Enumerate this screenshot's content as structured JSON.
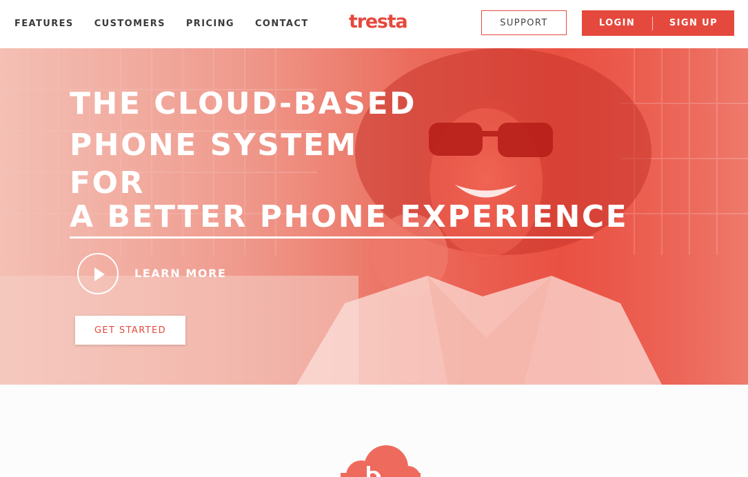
{
  "nav": {
    "links": [
      "FEATURES",
      "CUSTOMERS",
      "PRICING",
      "CONTACT"
    ],
    "logo": "tresta",
    "support_label": "SUPPORT",
    "login_label": "LOGIN",
    "signup_label": "SIGN UP"
  },
  "hero": {
    "headline": {
      "line1": "THE CLOUD-BASED",
      "line2": "PHONE SYSTEM",
      "line3": "FOR",
      "line4": "A BETTER PHONE EXPERIENCE"
    },
    "learn_more_label": "LEARN MORE",
    "get_started_label": "GET STARTED",
    "image": "woman-on-phone-photo"
  },
  "colors": {
    "brand": "#e5493d",
    "nav_text": "#3a3a3a",
    "hero_overlay": "#e9493b"
  },
  "icons": {
    "play": "play-icon",
    "cloud": "cloud-logo-icon"
  }
}
